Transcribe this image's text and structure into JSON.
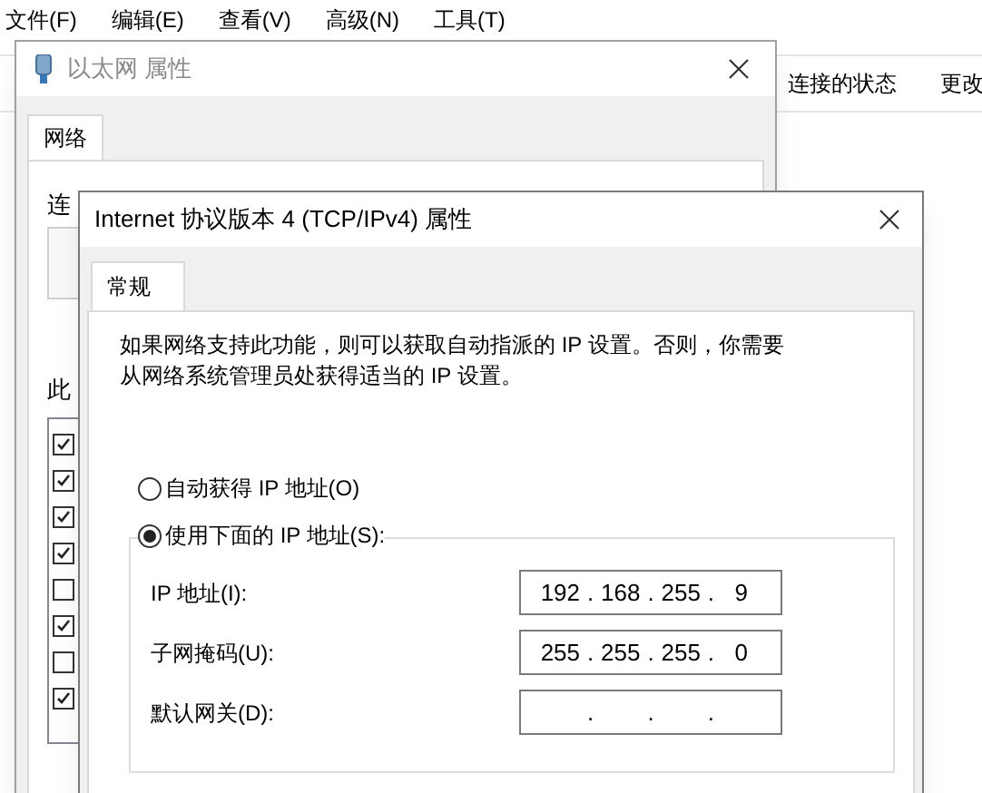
{
  "main_window": {
    "menu": [
      "文件(F)",
      "编辑(E)",
      "查看(V)",
      "高级(N)",
      "工具(T)"
    ],
    "toolbar": [
      "连接的状态",
      "更改"
    ]
  },
  "ethernet_dialog": {
    "title": "以太网 属性",
    "tabs": [
      {
        "label": "网络",
        "selected": true
      }
    ],
    "connect_label": "连",
    "items_label": "此",
    "components": [
      {
        "checked": true
      },
      {
        "checked": true
      },
      {
        "checked": true
      },
      {
        "checked": true
      },
      {
        "checked": false
      },
      {
        "checked": true
      },
      {
        "checked": false
      },
      {
        "checked": true
      }
    ]
  },
  "ipv4_dialog": {
    "title": "Internet 协议版本 4 (TCP/IPv4) 属性",
    "tabs": [
      {
        "label": "常规",
        "selected": true
      }
    ],
    "description": "如果网络支持此功能，则可以获取自动指派的 IP 设置。否则，你需要从网络系统管理员处获得适当的 IP 设置。",
    "options": [
      {
        "label": "自动获得 IP 地址(O)",
        "selected": false
      },
      {
        "label": "使用下面的 IP 地址(S):",
        "selected": true
      }
    ],
    "fields": [
      {
        "label": "IP 地址(I):",
        "octets": [
          "192",
          "168",
          "255",
          "9"
        ],
        "separators": [
          ".",
          ".",
          "."
        ]
      },
      {
        "label": "子网掩码(U):",
        "octets": [
          "255",
          "255",
          "255",
          "0"
        ],
        "separators": [
          ".",
          ".",
          "."
        ]
      },
      {
        "label": "默认网关(D):",
        "separators": [
          ".",
          ".",
          "."
        ]
      }
    ]
  }
}
